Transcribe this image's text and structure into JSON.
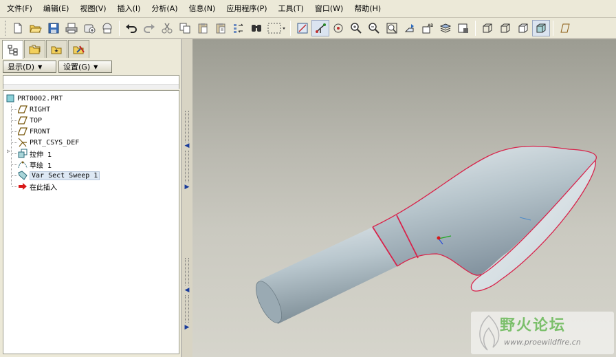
{
  "menubar": {
    "items": [
      "文件(F)",
      "编辑(E)",
      "视图(V)",
      "插入(I)",
      "分析(A)",
      "信息(N)",
      "应用程序(P)",
      "工具(T)",
      "窗口(W)",
      "帮助(H)"
    ]
  },
  "toolbar": {
    "icons": [
      "new-icon",
      "open-icon",
      "save-icon",
      "print-icon",
      "send-icon",
      "mail-icon",
      "undo-icon",
      "redo-icon",
      "cut-icon",
      "copy-icon",
      "paste-icon",
      "paste-special-icon",
      "regenerate-icon",
      "find-icon",
      "select-box-icon",
      "repaint-icon",
      "spin-center-icon",
      "orient-icon",
      "zoom-in-icon",
      "zoom-out-icon",
      "refit-icon",
      "reorient-icon",
      "named-views-icon",
      "layers-icon",
      "view-manager-icon",
      "wireframe-icon",
      "hidden-line-icon",
      "no-hidden-icon",
      "shading-icon",
      "datum-plane-icon"
    ],
    "pressed": [
      "orient-icon",
      "shading-icon"
    ]
  },
  "left_panel": {
    "tabs": [
      "model-tree-tab",
      "folder-tab",
      "favorites-tab",
      "connections-tab"
    ],
    "show_button": "显示(D)",
    "settings_button": "设置(G)"
  },
  "model_tree": {
    "root": "PRT0002.PRT",
    "items": [
      {
        "label": "RIGHT",
        "icon": "datum-plane-icon"
      },
      {
        "label": "TOP",
        "icon": "datum-plane-icon"
      },
      {
        "label": "FRONT",
        "icon": "datum-plane-icon"
      },
      {
        "label": "PRT_CSYS_DEF",
        "icon": "csys-icon"
      },
      {
        "label": "拉伸 1",
        "icon": "extrude-icon",
        "expandable": true
      },
      {
        "label": "草绘 1",
        "icon": "sketch-icon"
      },
      {
        "label": "Var Sect Sweep 1",
        "icon": "sweep-icon",
        "selected": true
      },
      {
        "label": "在此插入",
        "icon": "insert-here-arrow-icon"
      }
    ]
  },
  "watermark": {
    "title": "野火论坛",
    "url": "www.proewildfire.cn"
  },
  "colors": {
    "model_fill": "#b4c4cc",
    "edge_highlight": "#d8224a",
    "background_top": "#9c9c92",
    "background_bottom": "#d6d5cc",
    "watermark_green": "#7bbf6b"
  }
}
